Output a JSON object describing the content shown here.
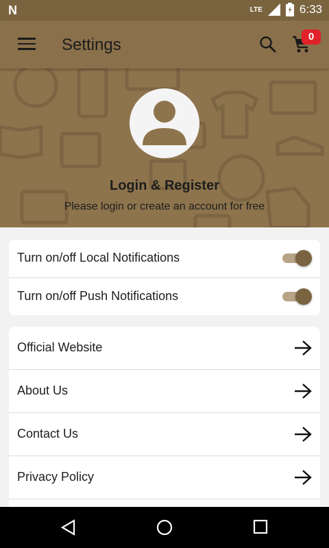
{
  "status_bar": {
    "network": "LTE",
    "time": "6:33"
  },
  "app_bar": {
    "title": "Settings",
    "cart_count": "0"
  },
  "header": {
    "title": "Login & Register",
    "subtitle": "Please login or create an account for free"
  },
  "notifications": [
    {
      "label": "Turn on/off Local Notifications",
      "enabled": true
    },
    {
      "label": "Turn on/off Push Notifications",
      "enabled": true
    }
  ],
  "links": [
    {
      "label": "Official Website"
    },
    {
      "label": "About Us"
    },
    {
      "label": "Contact Us"
    },
    {
      "label": "Privacy Policy"
    }
  ],
  "colors": {
    "primary": "#8a704b",
    "status_bar": "#7a6440",
    "badge": "#e0222b",
    "toggle_thumb": "#7a6440",
    "toggle_track": "#b8a486"
  }
}
